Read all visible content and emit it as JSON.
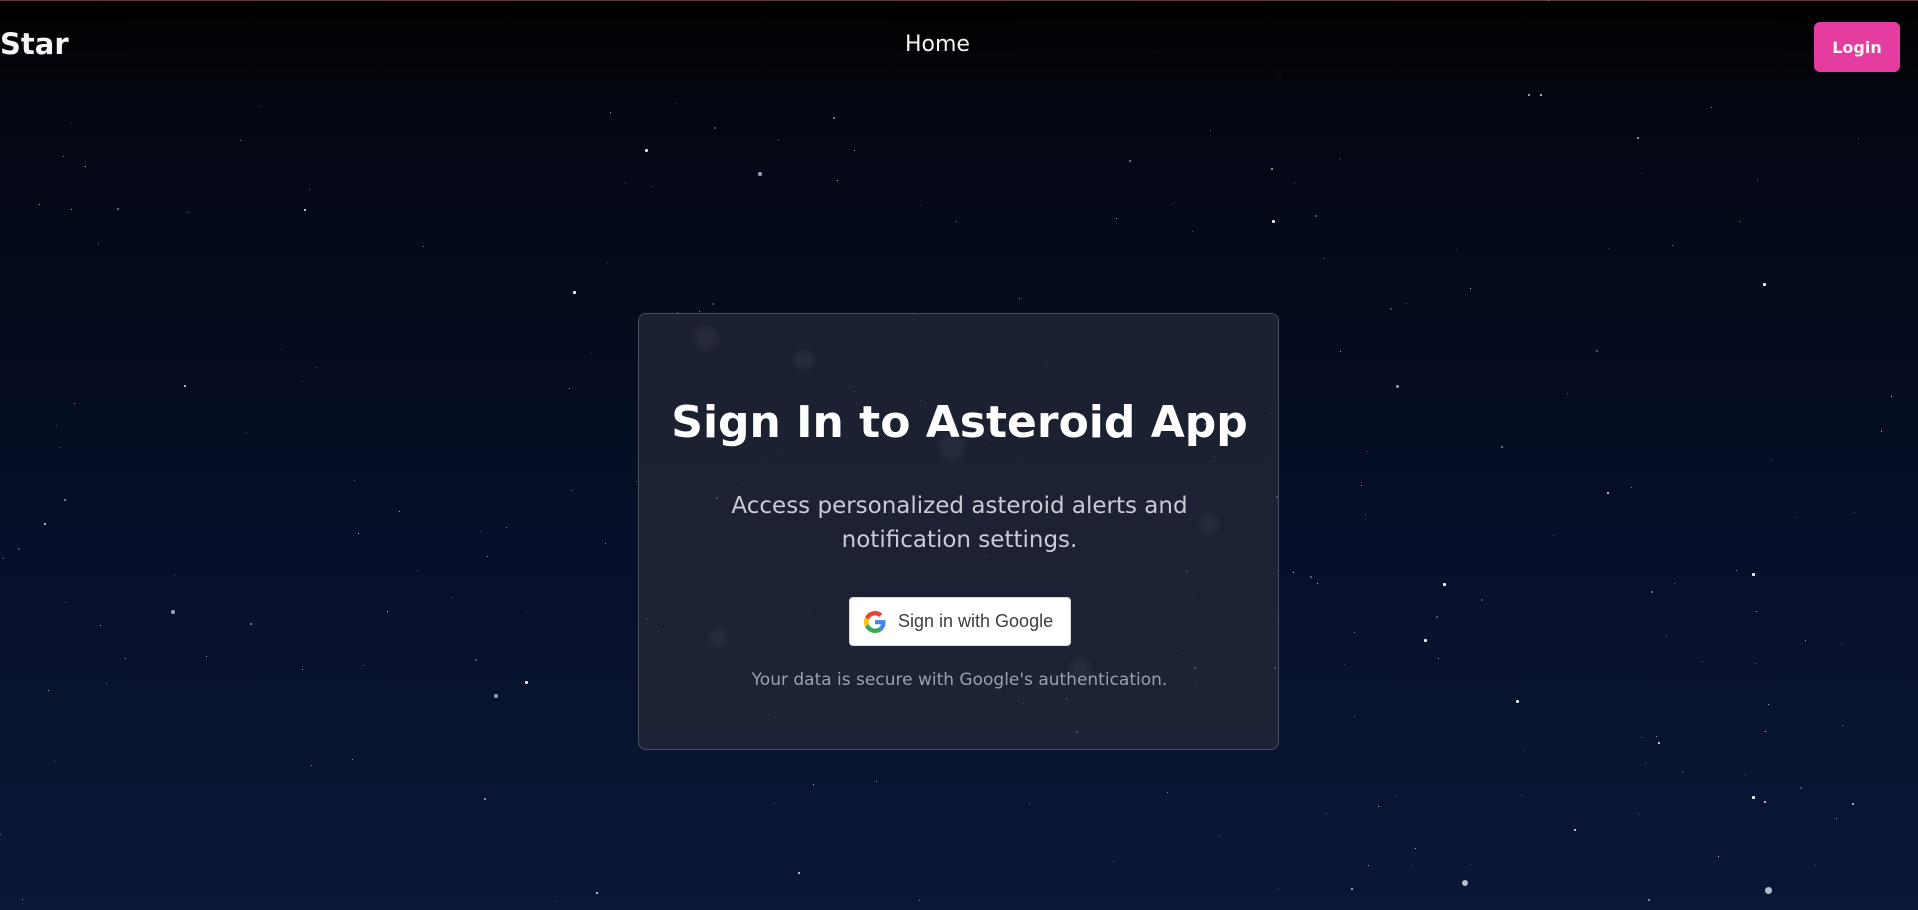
{
  "header": {
    "brand": "Star",
    "nav_home": "Home",
    "login_label": "Login"
  },
  "signin_card": {
    "title": "Sign In to Asteroid App",
    "subtitle": "Access personalized asteroid alerts and notification settings.",
    "google_button_label": "Sign in with Google",
    "google_icon": "google-logo-icon",
    "secure_note": "Your data is secure with Google's authentication."
  },
  "colors": {
    "accent": "#ef3fa6",
    "background": "#07102a",
    "card_background": "#262a38",
    "text_primary": "#ffffff",
    "text_secondary": "#c9ccd4",
    "text_muted": "#9ba0ad"
  }
}
